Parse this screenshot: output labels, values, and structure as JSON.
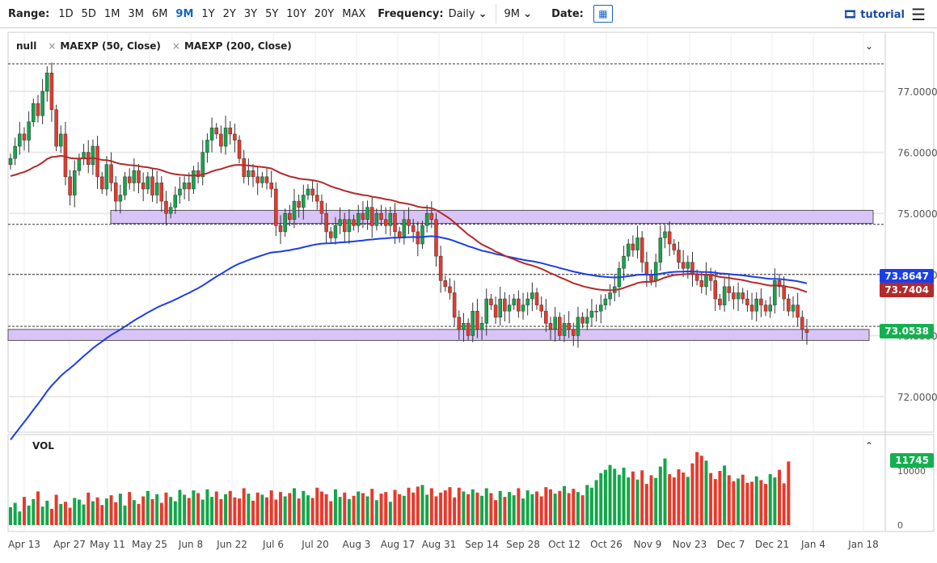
{
  "toolbar": {
    "range_label": "Range:",
    "ranges": [
      "1D",
      "5D",
      "1M",
      "3M",
      "6M",
      "9M",
      "1Y",
      "2Y",
      "3Y",
      "5Y",
      "10Y",
      "20Y",
      "MAX"
    ],
    "active_range": "9M",
    "frequency_label": "Frequency:",
    "frequency": "Daily",
    "period": "9M",
    "date_label": "Date:",
    "tutorial": "tutorial"
  },
  "legend": {
    "symbol": "null",
    "ma1": "MAEXP (50, Close)",
    "ma2": "MAEXP (200, Close)",
    "vol": "VOL"
  },
  "price_axis": [
    "77.0000",
    "76.0000",
    "75.0000",
    "74.0000",
    "73.0000",
    "72.0000"
  ],
  "price_tags": {
    "ma200": "73.8647",
    "ma50": "73.7404",
    "last": "73.0538"
  },
  "vol_axis": [
    "10000",
    "0"
  ],
  "vol_tag": "11745",
  "x_labels": [
    "Apr 13",
    "Apr 27",
    "May 11",
    "May 25",
    "Jun 8",
    "Jun 22",
    "Jul 6",
    "Jul 20",
    "Aug 3",
    "Aug 17",
    "Aug 31",
    "Sep 14",
    "Sep 28",
    "Oct 12",
    "Oct 26",
    "Nov 9",
    "Nov 23",
    "Dec 7",
    "Dec 21",
    "Jan 4",
    "Jan 18"
  ],
  "colors": {
    "up": "#13a64a",
    "down": "#e8392b",
    "ma50": "#b32a2a",
    "ma200": "#1c3ee8",
    "zone": "#d9c4f7"
  },
  "chart_data": {
    "type": "candlestick",
    "closes": [
      75.9,
      76.1,
      76.3,
      76.2,
      76.5,
      76.8,
      76.6,
      77.0,
      77.3,
      76.7,
      76.1,
      76.3,
      75.6,
      75.3,
      75.7,
      75.9,
      76.0,
      75.8,
      76.1,
      75.6,
      75.4,
      75.8,
      75.5,
      75.2,
      75.3,
      75.6,
      75.5,
      75.7,
      75.5,
      75.4,
      75.6,
      75.3,
      75.5,
      75.2,
      75.0,
      75.1,
      75.3,
      75.4,
      75.5,
      75.4,
      75.7,
      75.6,
      76.0,
      76.2,
      76.4,
      76.3,
      76.1,
      76.4,
      76.3,
      76.2,
      75.9,
      75.6,
      75.7,
      75.6,
      75.5,
      75.6,
      75.5,
      75.4,
      74.8,
      74.7,
      75.0,
      74.9,
      75.2,
      75.1,
      75.3,
      75.4,
      75.3,
      75.2,
      75.0,
      74.7,
      74.6,
      74.8,
      74.9,
      74.7,
      74.9,
      74.8,
      75.0,
      74.9,
      75.1,
      74.8,
      75.0,
      74.9,
      74.8,
      75.0,
      74.7,
      74.6,
      74.9,
      74.8,
      74.7,
      74.5,
      74.8,
      75.0,
      74.9,
      74.3,
      73.9,
      73.8,
      73.7,
      73.3,
      73.1,
      73.2,
      73.0,
      73.4,
      73.1,
      73.2,
      73.6,
      73.5,
      73.3,
      73.6,
      73.4,
      73.5,
      73.6,
      73.4,
      73.5,
      73.6,
      73.7,
      73.5,
      73.4,
      73.2,
      73.1,
      73.3,
      73.0,
      73.2,
      73.1,
      73.0,
      73.3,
      73.2,
      73.3,
      73.4,
      73.4,
      73.5,
      73.6,
      73.7,
      73.8,
      74.1,
      74.3,
      74.5,
      74.4,
      74.6,
      74.2,
      74.0,
      73.9,
      74.2,
      74.6,
      74.7,
      74.5,
      74.4,
      74.2,
      74.1,
      74.2,
      74.0,
      73.9,
      73.8,
      74.0,
      73.9,
      73.6,
      73.5,
      73.8,
      73.7,
      73.6,
      73.7,
      73.6,
      73.5,
      73.4,
      73.6,
      73.5,
      73.4,
      73.5,
      73.9,
      73.8,
      73.6,
      73.4,
      73.5,
      73.3,
      73.1,
      73.05
    ],
    "volumes": [
      3300,
      4100,
      2500,
      5200,
      3600,
      4800,
      6200,
      3400,
      4500,
      3000,
      5600,
      3900,
      4300,
      3200,
      5000,
      4700,
      3800,
      6000,
      4400,
      5100,
      3700,
      4900,
      5500,
      4200,
      5800,
      3600,
      6100,
      4600,
      3900,
      5300,
      6300,
      4800,
      5700,
      4100,
      6000,
      5200,
      4400,
      6500,
      5600,
      5000,
      6400,
      5900,
      4700,
      6600,
      5200,
      6200,
      4800,
      5700,
      6300,
      5100,
      4900,
      6800,
      5800,
      4500,
      6000,
      5600,
      5100,
      6400,
      4700,
      6100,
      5300,
      5900,
      6800,
      4900,
      6300,
      5500,
      5000,
      6900,
      6200,
      5700,
      4400,
      6600,
      5200,
      6000,
      4800,
      5400,
      6200,
      5900,
      5300,
      6700,
      4600,
      5800,
      6100,
      4300,
      6500,
      5700,
      5400,
      6900,
      6000,
      7100,
      7400,
      5600,
      6800,
      5300,
      6000,
      6400,
      7000,
      5100,
      6900,
      6200,
      5700,
      6600,
      6000,
      5400,
      6800,
      5900,
      4600,
      6300,
      5200,
      6100,
      5500,
      6800,
      4900,
      6400,
      5700,
      6200,
      5300,
      7000,
      6600,
      5800,
      6300,
      7200,
      5900,
      6700,
      6100,
      5500,
      7400,
      6900,
      8300,
      9600,
      10200,
      11100,
      10400,
      9300,
      10600,
      8800,
      9900,
      8400,
      10100,
      7600,
      9200,
      8700,
      10800,
      12300,
      9400,
      8800,
      10300,
      9700,
      8900,
      11400,
      13500,
      12800,
      11900,
      9600,
      8500,
      10000,
      11000,
      9200,
      8100,
      8600,
      9300,
      7800,
      8000,
      9000,
      8300,
      7600,
      9400,
      8800,
      10200,
      7700,
      11745
    ]
  }
}
